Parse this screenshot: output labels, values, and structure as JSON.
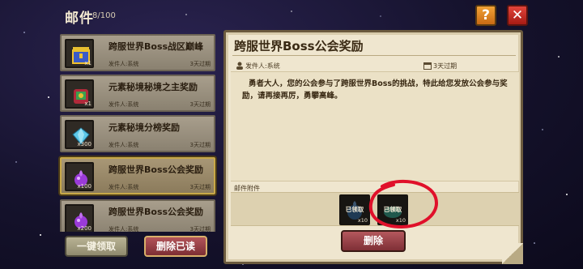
{
  "header": {
    "title": "邮件",
    "count": "8/100"
  },
  "buttons": {
    "help": "?",
    "close": "✕",
    "collect_all": "一键领取",
    "delete_read": "删除已读",
    "delete": "删除"
  },
  "mail_list": [
    {
      "title": "跨服世界Boss战区巅峰",
      "sender": "发件人:系统",
      "expiry": "3天过期",
      "qty": "x1",
      "icon": "chest-icon",
      "selected": false
    },
    {
      "title": "元素秘境秘境之主奖励",
      "sender": "发件人:系统",
      "expiry": "3天过期",
      "qty": "x1",
      "icon": "bag-icon",
      "selected": false
    },
    {
      "title": "元素秘境分榜奖励",
      "sender": "发件人:系统",
      "expiry": "3天过期",
      "qty": "x300",
      "icon": "gem-icon",
      "selected": false
    },
    {
      "title": "跨服世界Boss公会奖励",
      "sender": "发件人:系统",
      "expiry": "3天过期",
      "qty": "x100",
      "icon": "potion-icon",
      "selected": true
    },
    {
      "title": "跨服世界Boss公会奖励",
      "sender": "发件人:系统",
      "expiry": "3天过期",
      "qty": "x200",
      "icon": "potion-icon",
      "selected": false
    }
  ],
  "detail": {
    "title": "跨服世界Boss公会奖励",
    "sender": "发件人:系统",
    "expiry": "3天过期",
    "content": "勇者大人，您的公会参与了跨服世界Boss的挑战，特此给您发放公会参与奖励，请再接再厉，勇攀高峰。",
    "attach_label": "邮件附件",
    "attachments": [
      {
        "status": "已领取",
        "qty": "x10",
        "icon": "potion-icon"
      },
      {
        "status": "已领取",
        "qty": "x10",
        "icon": "bowl-icon"
      }
    ]
  },
  "colors": {
    "accent_red": "#e0102a",
    "panel_bg": "#efe6cf",
    "selected_border": "#c8a848"
  }
}
